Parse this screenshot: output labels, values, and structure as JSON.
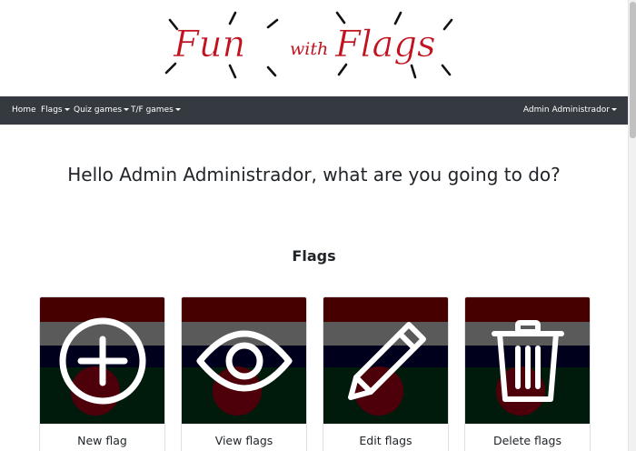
{
  "logo": {
    "text_fun": "Fun",
    "text_with": "with",
    "text_flags": "Flags",
    "color": "#c1121f"
  },
  "navbar": {
    "items": [
      {
        "label": "Home",
        "dropdown": false
      },
      {
        "label": "Flags",
        "dropdown": true
      },
      {
        "label": "Quiz games",
        "dropdown": true
      },
      {
        "label": "T/F games",
        "dropdown": true
      }
    ],
    "user_menu": {
      "label": "Admin Administrador",
      "dropdown": true
    },
    "background": "#343a40"
  },
  "main": {
    "greeting": "Hello Admin Administrador, what are you going to do?",
    "section_title": "Flags",
    "cards": [
      {
        "label": "New flag",
        "icon": "plus-circle-icon"
      },
      {
        "label": "View flags",
        "icon": "eye-icon"
      },
      {
        "label": "Edit flags",
        "icon": "pencil-icon"
      },
      {
        "label": "Delete flags",
        "icon": "trash-icon"
      }
    ]
  }
}
